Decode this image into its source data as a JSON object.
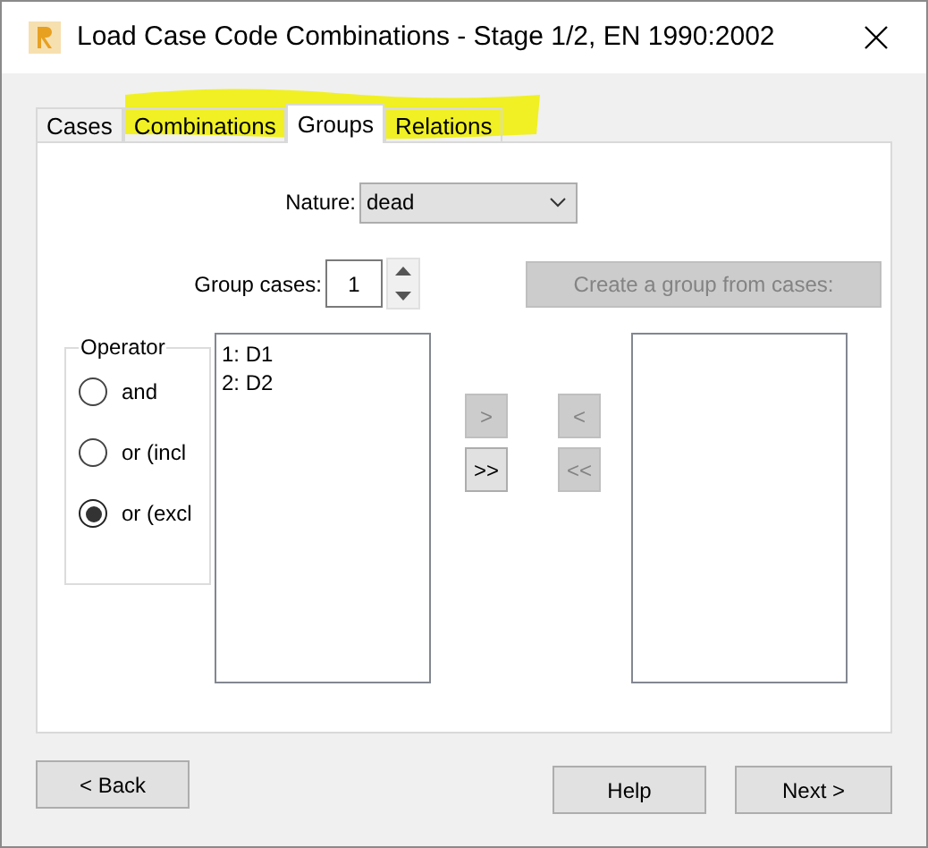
{
  "window": {
    "title": "Load Case Code Combinations - Stage 1/2, EN 1990:2002"
  },
  "tabs": [
    {
      "label": "Cases",
      "selected": false
    },
    {
      "label": "Combinations",
      "selected": false
    },
    {
      "label": "Groups",
      "selected": true
    },
    {
      "label": "Relations",
      "selected": false
    }
  ],
  "nature": {
    "label": "Nature:",
    "value": "dead"
  },
  "group_cases": {
    "label": "Group cases:",
    "value": "1"
  },
  "create_button": {
    "label": "Create a group from cases:",
    "disabled": true
  },
  "operator": {
    "title": "Operator",
    "options": [
      {
        "label": "and",
        "selected": false
      },
      {
        "label": "or (incl",
        "selected": false
      },
      {
        "label": "or (excl",
        "selected": true
      }
    ]
  },
  "source_list": [
    "1: D1",
    "2: D2"
  ],
  "move_buttons": [
    {
      "label": ">",
      "disabled": true
    },
    {
      "label": "<",
      "disabled": true
    },
    {
      "label": ">>",
      "disabled": false
    },
    {
      "label": "<<",
      "disabled": true
    }
  ],
  "footer": {
    "back": "< Back",
    "help": "Help",
    "next": "Next >"
  }
}
